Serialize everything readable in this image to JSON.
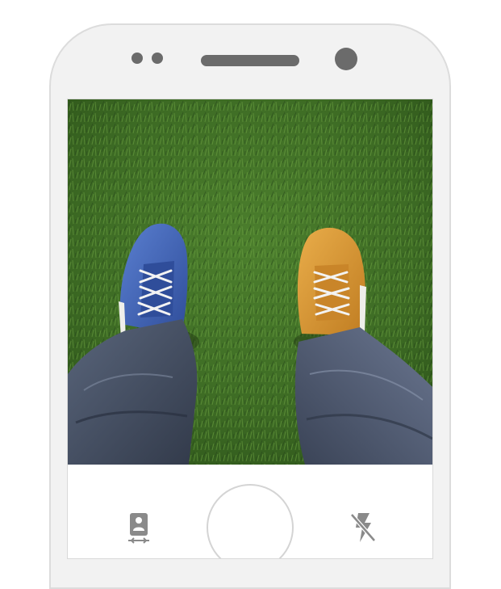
{
  "device": {
    "frame_color": "#f2f2f2",
    "bezel_elements": [
      "sensor",
      "sensor",
      "earpiece-speaker",
      "front-camera"
    ]
  },
  "viewfinder": {
    "scene": "camera-preview",
    "colors": {
      "grass": "#3d6b24",
      "left_shoe": "#3f63b8",
      "right_shoe": "#d8962f",
      "jeans": "#3c4456"
    }
  },
  "controls": {
    "switch_camera": {
      "icon": "switch-camera-icon",
      "color": "#8a8a8a"
    },
    "shutter": {
      "icon": "shutter-button"
    },
    "flash": {
      "icon": "flash-off-icon",
      "state": "off",
      "color": "#8a8a8a"
    }
  }
}
